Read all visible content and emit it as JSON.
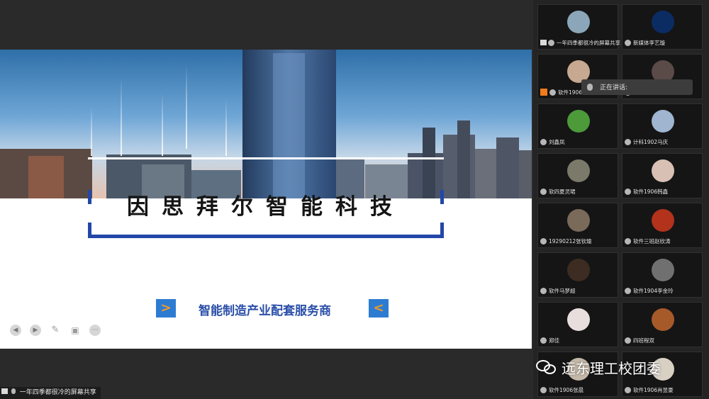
{
  "share_label": "一年四季都很冷的屏幕共享",
  "slide": {
    "company_title": "因思拜尔智能科技",
    "tagline": "智能制造产业配套服务商",
    "arrow_left": ">",
    "arrow_right": "<",
    "controls": [
      "previous-icon",
      "next-icon",
      "pen-icon",
      "fit-icon",
      "more-icon"
    ]
  },
  "speaking": {
    "label": "正在讲话:"
  },
  "participants": [
    {
      "name": "一年四季都很冷的屏幕共享",
      "sharing": true,
      "avatar_color": "#8aa6b8"
    },
    {
      "name": "新媒体李艺璇",
      "avatar_color": "#0b2c63"
    },
    {
      "name": "软件1906",
      "host": true,
      "avatar_color": "#c7a890"
    },
    {
      "name": "",
      "avatar_color": "#5a4a48"
    },
    {
      "name": "刘鑫凤",
      "avatar_color": "#4c9a3a"
    },
    {
      "name": "计科1902马庆",
      "avatar_color": "#9fb5d0"
    },
    {
      "name": "软四夏灵珺",
      "avatar_color": "#7b7a6a"
    },
    {
      "name": "软件1906韩鑫",
      "avatar_color": "#d8c0b4"
    },
    {
      "name": "19290212张钦瑜",
      "avatar_color": "#7a6a5a"
    },
    {
      "name": "软件三班赵欣涛",
      "avatar_color": "#b2321c"
    },
    {
      "name": "软件马梦超",
      "avatar_color": "#3c2c22"
    },
    {
      "name": "软件1904李金玲",
      "avatar_color": "#707070"
    },
    {
      "name": "郑佳",
      "avatar_color": "#e9dede"
    },
    {
      "name": "四班程双",
      "avatar_color": "#a65a2a"
    },
    {
      "name": "软件1906张晨",
      "avatar_color": "#c4b8a8"
    },
    {
      "name": "软件1906肖昱豪",
      "avatar_color": "#d9d0c4"
    }
  ],
  "watermark": "远东理工校团委"
}
